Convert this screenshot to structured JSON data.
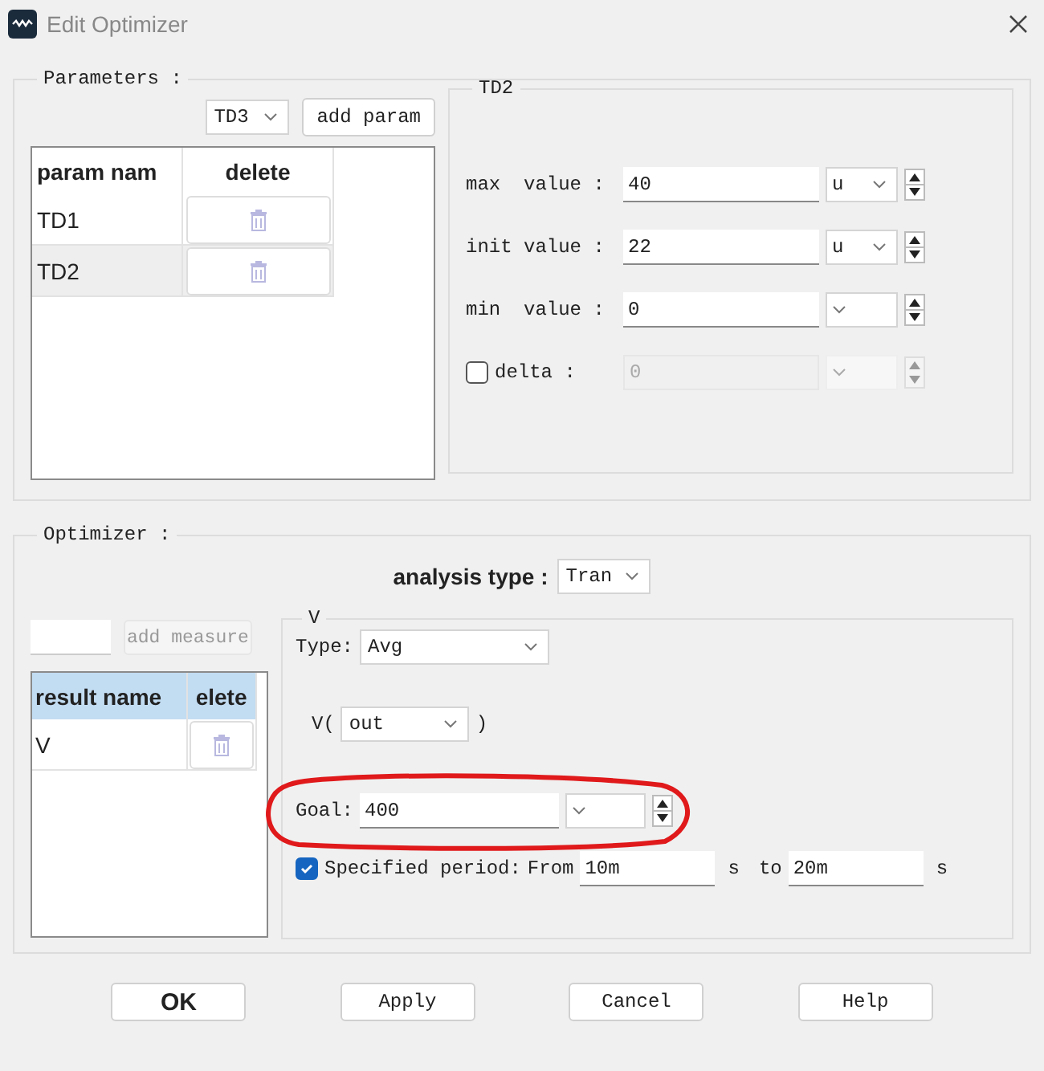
{
  "window": {
    "title": "Edit Optimizer"
  },
  "parameters": {
    "legend": "Parameters :",
    "param_select": "TD3",
    "add_button": "add param",
    "table": {
      "columns": [
        "param nam",
        "delete"
      ],
      "rows": [
        {
          "name": "TD1",
          "selected": false
        },
        {
          "name": "TD2",
          "selected": true
        }
      ]
    },
    "detail": {
      "title": "TD2",
      "fields": [
        {
          "label": "max  value :",
          "value": "40",
          "unit": "u"
        },
        {
          "label": "init value :",
          "value": "22",
          "unit": "u"
        },
        {
          "label": "min  value :",
          "value": "0"
        }
      ],
      "delta": {
        "label": "delta :",
        "checked": false,
        "value": "0"
      }
    }
  },
  "optimizer": {
    "legend": "Optimizer :",
    "analysis_label": "analysis type :",
    "analysis_value": "Tran",
    "add_button": {
      "label": "add measure",
      "disabled": true
    },
    "table": {
      "columns": [
        "result name",
        "elete"
      ],
      "rows": [
        {
          "name": "V",
          "selected": false
        }
      ]
    },
    "measure": {
      "title": "V",
      "type_label": "Type:",
      "type_value": "Avg",
      "expr_prefix": "V(",
      "expr_value": "out",
      "expr_suffix": ")",
      "goal_label": "Goal:",
      "goal_value": "400",
      "period": {
        "checked": true,
        "label": "Specified period:",
        "from_label": "From",
        "from": "10m",
        "from_unit": "s",
        "to_label": "to",
        "to": "20m",
        "to_unit": "s"
      }
    }
  },
  "buttons": [
    {
      "label": "OK",
      "default": true
    },
    {
      "label": "Apply",
      "default": false
    },
    {
      "label": "Cancel",
      "default": false
    },
    {
      "label": "Help",
      "default": false
    }
  ]
}
